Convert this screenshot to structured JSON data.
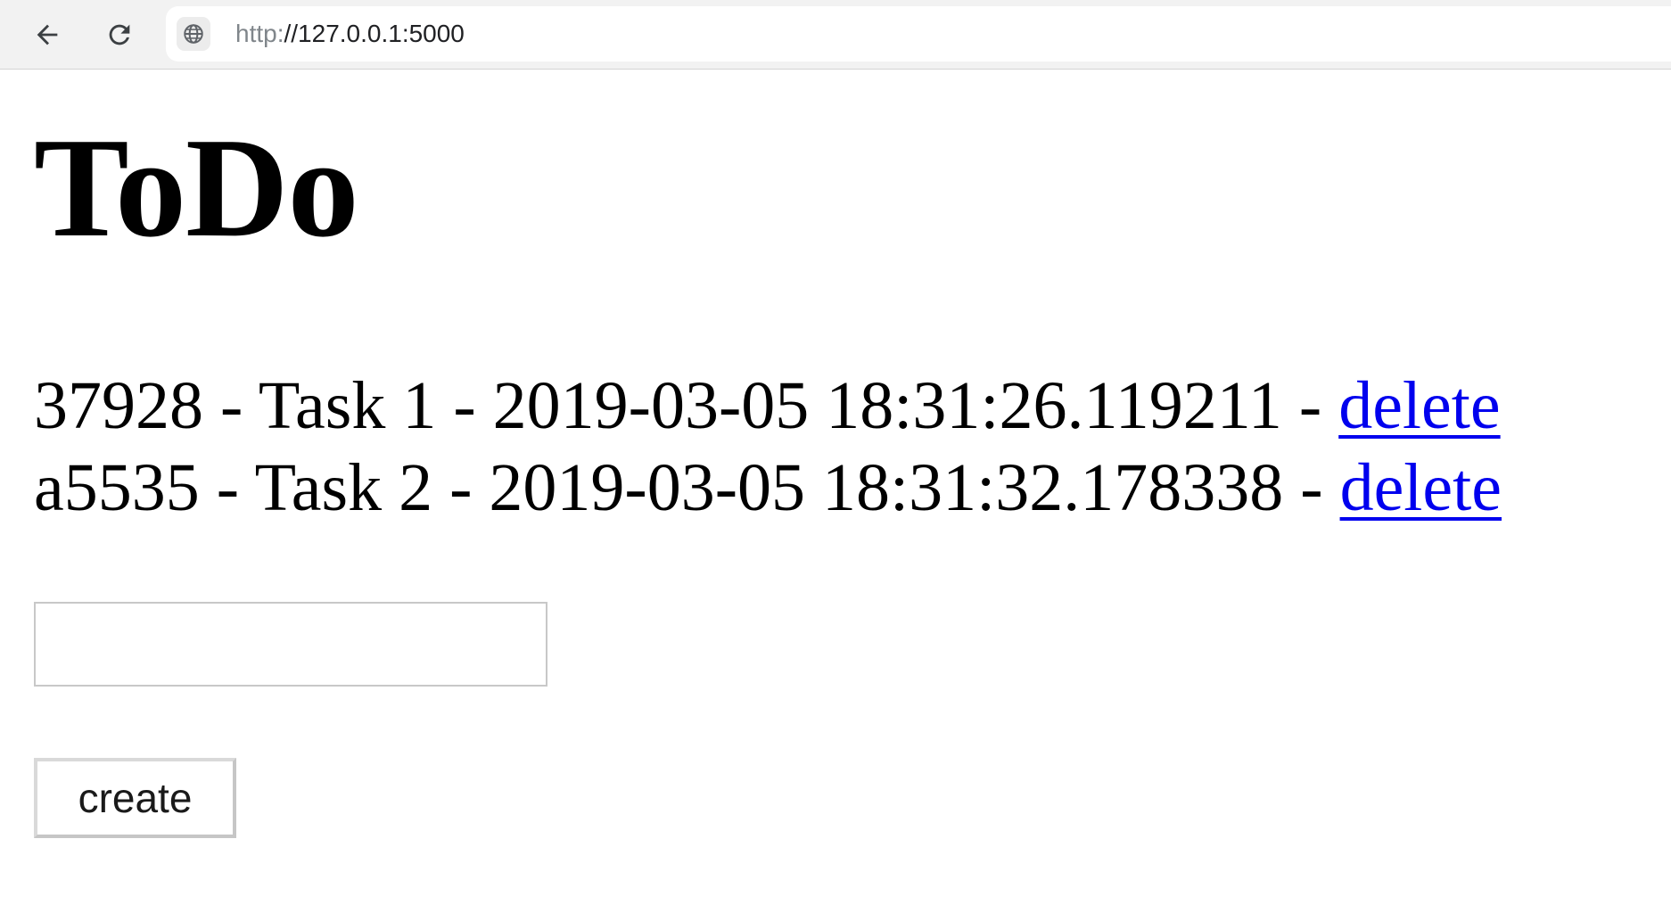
{
  "browser": {
    "back_icon": "arrow-left-icon",
    "reload_icon": "reload-icon",
    "site_icon": "globe-icon",
    "url_scheme": "http:",
    "url_rest": "//127.0.0.1:5000"
  },
  "page": {
    "title": "ToDo",
    "tasks": [
      {
        "text": "37928 - Task 1 - 2019-03-05 18:31:26.119211 - ",
        "action_label": "delete"
      },
      {
        "text": "a5535 - Task 2 - 2019-03-05 18:31:32.178338 - ",
        "action_label": "delete"
      }
    ],
    "new_task_input": {
      "value": "",
      "placeholder": ""
    },
    "create_label": "create"
  },
  "colors": {
    "link": "#0000ee",
    "toolbar_bg": "#f2f2f2",
    "text": "#000000"
  }
}
